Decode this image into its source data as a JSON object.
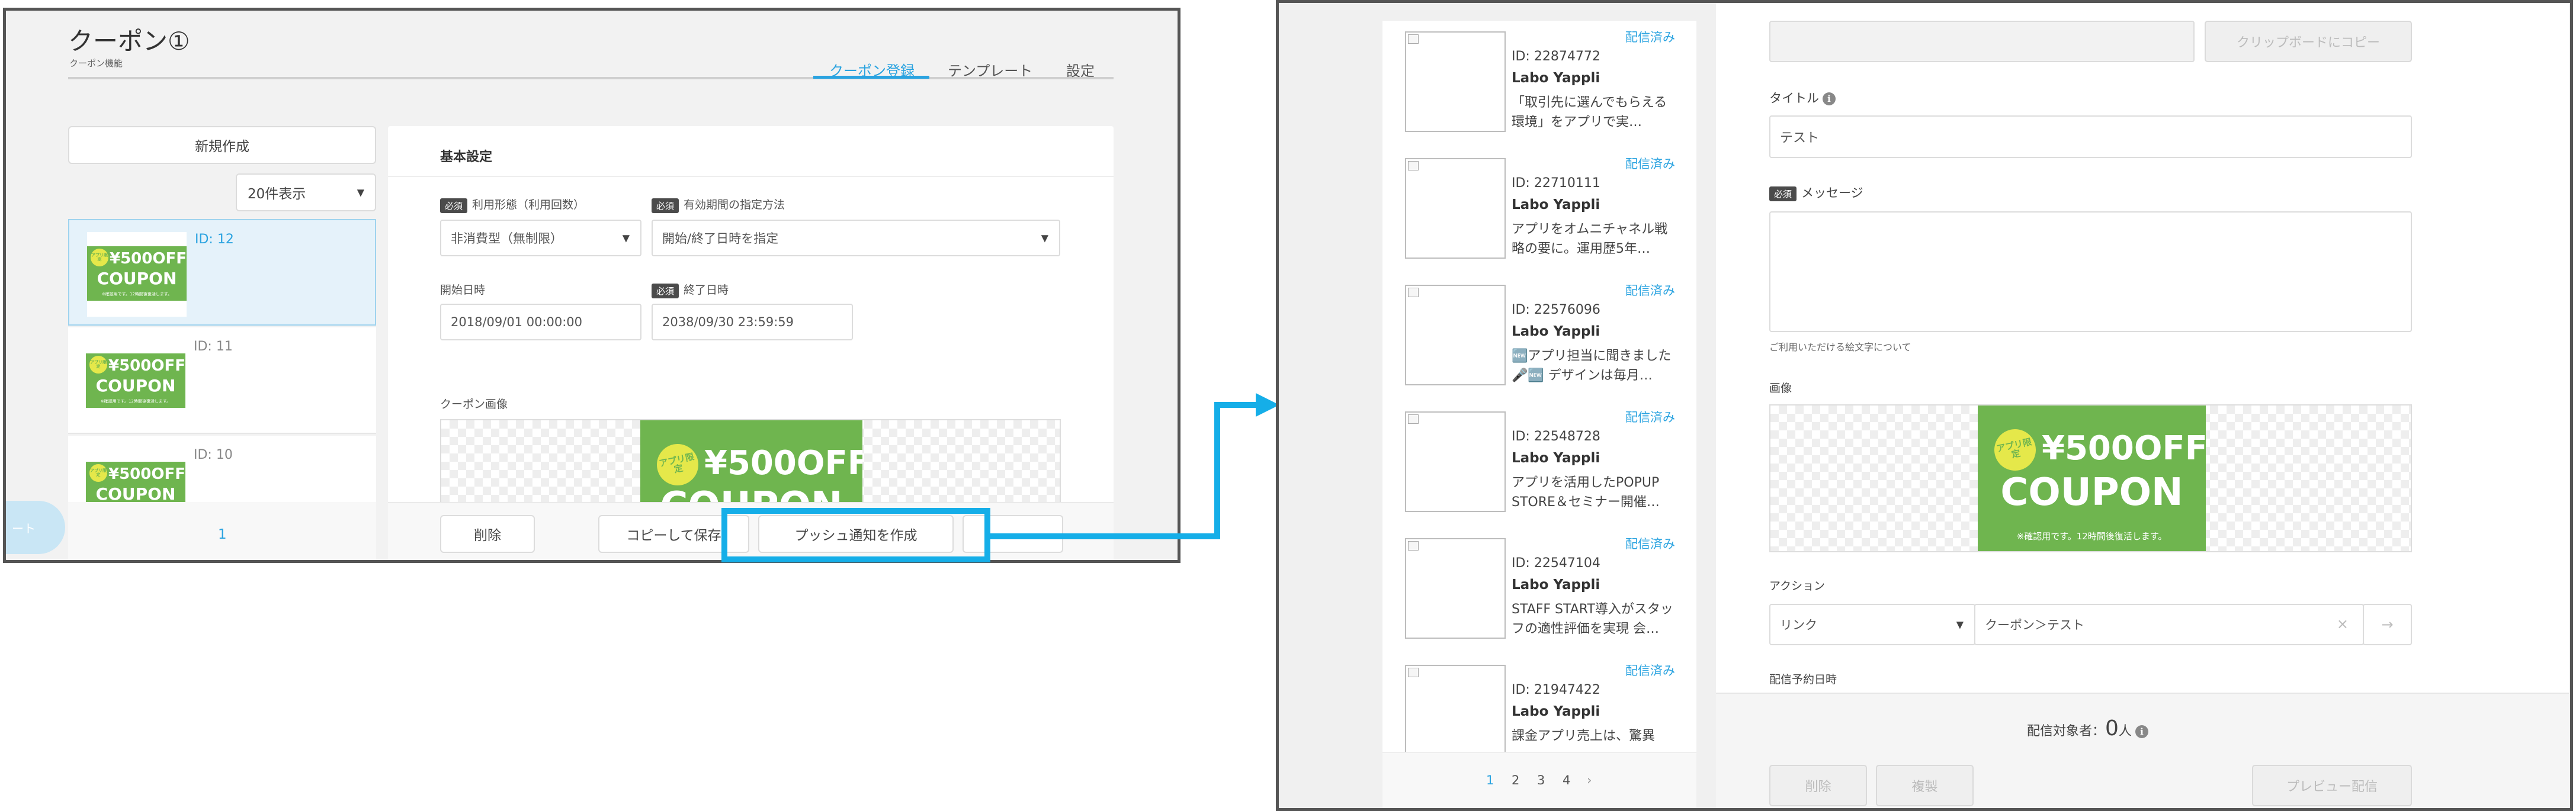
{
  "left": {
    "title": "クーポン①",
    "subtitle": "クーポン機能",
    "tabs": [
      "クーポン登録",
      "テンプレート",
      "設定"
    ],
    "new_button": "新規作成",
    "per_page": "20件表示",
    "items": [
      {
        "id": "ID: 12"
      },
      {
        "id": "ID: 11"
      },
      {
        "id": "ID: 10"
      }
    ],
    "pager_page": "1",
    "fab_text": "ート",
    "panel_header": "基本設定",
    "required": "必須",
    "usage_label": "利用形態（利用回数）",
    "usage_value": "非消費型（無制限）",
    "period_label": "有効期間の指定方法",
    "period_value": "開始/終了日時を指定",
    "start_label": "開始日時",
    "start_value": "2018/09/01 00:00:00",
    "end_label": "終了日時",
    "end_value": "2038/09/30 23:59:59",
    "image_label": "クーポン画像",
    "delete_button": "削除",
    "copy_save_button": "コピーして保存",
    "push_button": "プッシュ通知を作成"
  },
  "coupon": {
    "badge": "アプリ限定",
    "price": "¥500OFF",
    "word": "COUPON",
    "note": "※確認用です。12時間後復活します。"
  },
  "right": {
    "list": [
      {
        "status": "配信済み",
        "id": "ID: 22874772",
        "name": "Labo Yappli",
        "desc": "「取引先に選んでもらえる環境」をアプリで実…"
      },
      {
        "status": "配信済み",
        "id": "ID: 22710111",
        "name": "Labo Yappli",
        "desc": "アプリをオムニチャネル戦略の要に。運用歴5年…"
      },
      {
        "status": "配信済み",
        "id": "ID: 22576096",
        "name": "Labo Yappli",
        "desc": "🆕アプリ担当に聞きました🎤🆕 デザインは毎月…"
      },
      {
        "status": "配信済み",
        "id": "ID: 22548728",
        "name": "Labo Yappli",
        "desc": "アプリを活用したPOPUP STORE＆セミナー開催…"
      },
      {
        "status": "配信済み",
        "id": "ID: 22547104",
        "name": "Labo Yappli",
        "desc": "STAFF START導入がスタッフの適性評価を実現 会…"
      },
      {
        "status": "配信済み",
        "id": "ID: 21947422",
        "name": "Labo Yappli",
        "desc": "課金アプリ売上は、驚異"
      }
    ],
    "pages": [
      "1",
      "2",
      "3",
      "4",
      "›"
    ],
    "clipboard_button": "クリップボードにコピー",
    "title_label": "タイトル",
    "title_value": "テスト",
    "required": "必須",
    "message_label": "メッセージ",
    "emoji_note": "ご利用いただける絵文字について",
    "image_label": "画像",
    "action_label": "アクション",
    "action_type": "リンク",
    "action_value": "クーポン＞テスト",
    "schedule_label": "配信予約日時",
    "target_prefix": "配信対象者：",
    "target_count": "0",
    "target_unit": "人",
    "delete_button": "削除",
    "duplicate_button": "複製",
    "preview_button": "プレビュー配信"
  },
  "colors": {
    "accent": "#2aa3e0",
    "highlight": "#15aee8",
    "coupon_green": "#6fb54f",
    "badge_yellow": "#e5e84a"
  }
}
